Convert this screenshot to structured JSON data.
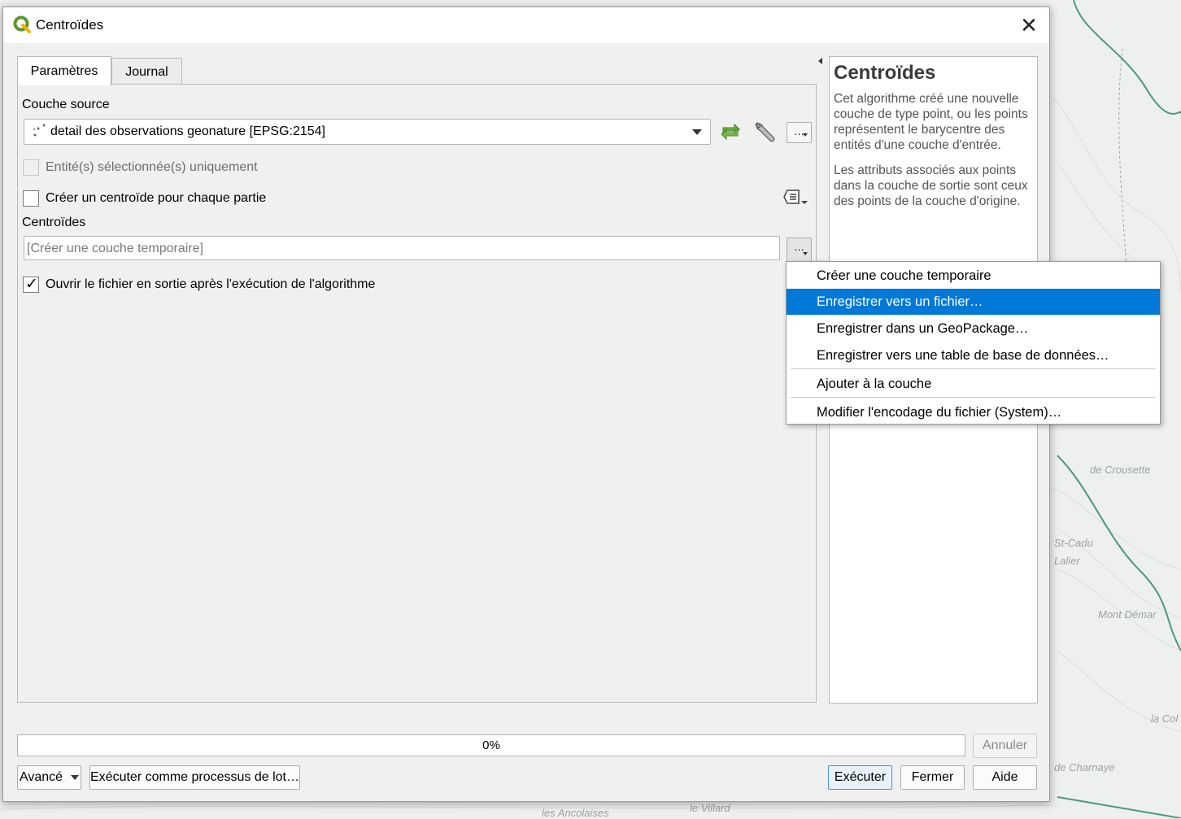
{
  "window": {
    "title": "Centroïdes",
    "close_glyph": "✕"
  },
  "tabs": [
    {
      "label": "Paramètres",
      "active": true
    },
    {
      "label": "Journal",
      "active": false
    }
  ],
  "params": {
    "source_layer_label": "Couche source",
    "source_layer_value": "detail des observations geonature [EPSG:2154]",
    "dots_label": "…",
    "selected_only_label": "Entité(s) sélectionnée(s) uniquement",
    "selected_only_checked": false,
    "each_part_label": "Créer un centroïde pour chaque partie",
    "each_part_checked": false,
    "output_label": "Centroïdes",
    "output_placeholder": "[Créer une couche temporaire]",
    "open_output_label": "Ouvrir le fichier en sortie après l'exécution de l'algorithme",
    "open_output_checked": true
  },
  "help": {
    "title": "Centroïdes",
    "paragraphs": [
      "Cet algorithme créé une nouvelle couche de type point, ou les points représentent le barycentre des entités d'une couche d'entrée.",
      "Les attributs associés aux points dans la couche de sortie sont ceux des points de la couche d'origine."
    ]
  },
  "output_menu": {
    "items": [
      {
        "label": "Créer une couche temporaire",
        "highlighted": false
      },
      {
        "label": "Enregistrer vers un fichier…",
        "highlighted": true
      },
      {
        "label": "Enregistrer dans un GeoPackage…",
        "highlighted": false
      },
      {
        "label": "Enregistrer vers une table de base de données…",
        "highlighted": false
      },
      {
        "label": "Ajouter à la couche",
        "highlighted": false
      },
      {
        "label": "Modifier l'encodage du fichier (System)…",
        "highlighted": false
      }
    ]
  },
  "footer": {
    "progress_text": "0%",
    "progress_value": 0,
    "cancel_label": "Annuler",
    "advanced_label": "Avancé",
    "batch_label": "Exécuter comme processus de lot…",
    "run_label": "Exécuter",
    "close_label": "Fermer",
    "help_label": "Aide"
  },
  "map_labels": [
    "de Crousette",
    "St-Cadu",
    "Mont Démar",
    "la Col",
    "de Charnaye",
    "le Villard",
    "les Ancolaises",
    "Lalier"
  ],
  "colors": {
    "accent": "#0078d7",
    "qgis_green": "#589632",
    "map_green": "#4a9a7a"
  },
  "icons": [
    "qgis-logo-icon",
    "point-layer-icon",
    "iterate-icon",
    "wrench-icon",
    "output-options-icon",
    "checkmark-icon"
  ]
}
